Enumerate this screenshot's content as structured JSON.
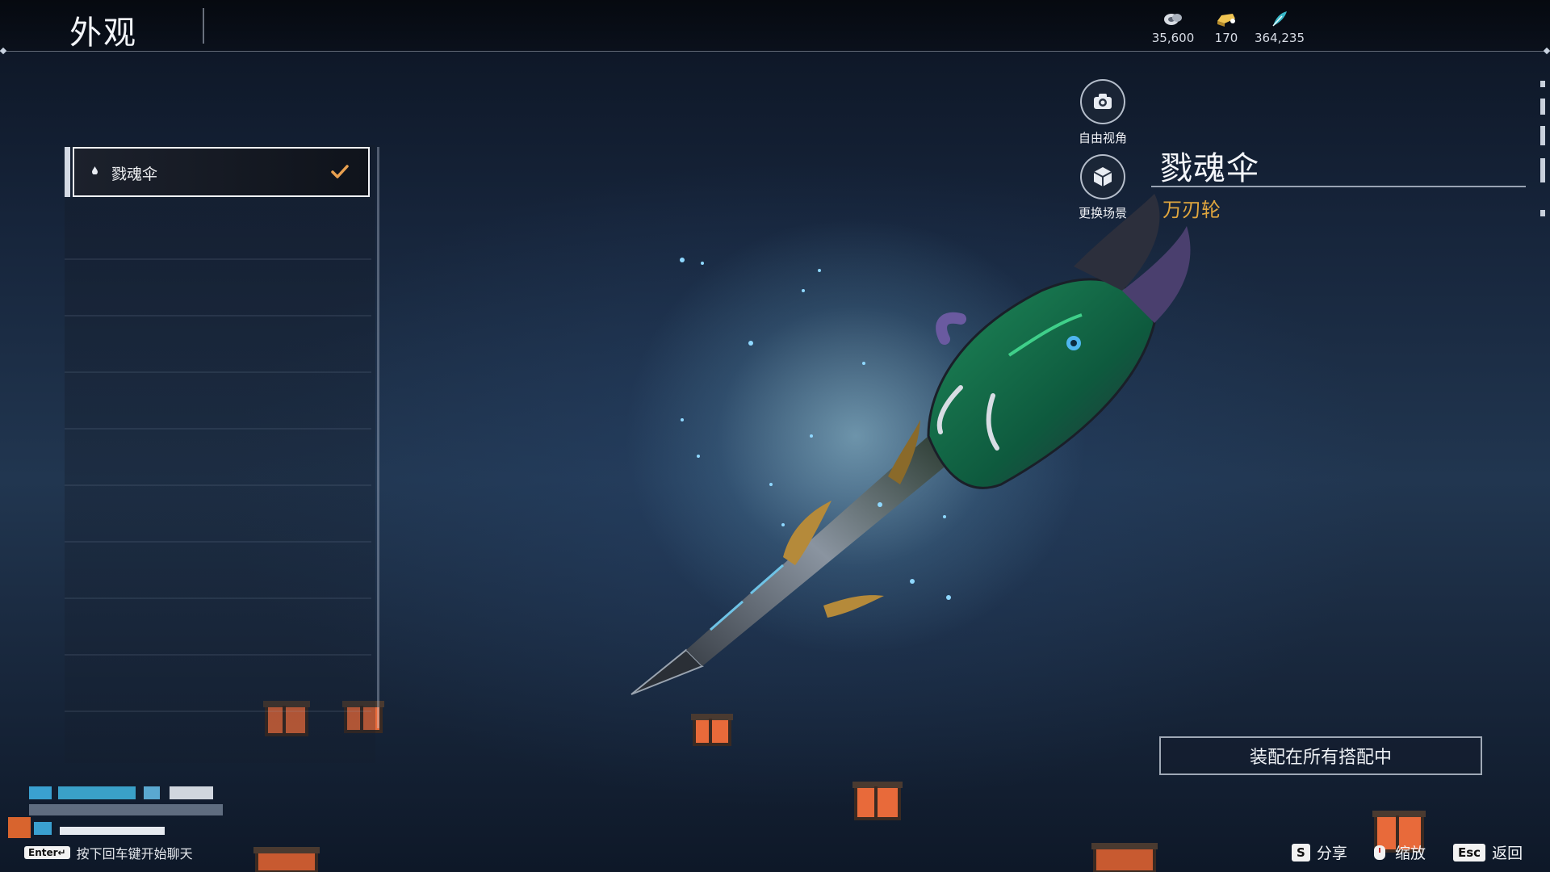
{
  "header": {
    "title": "外观"
  },
  "currencies": [
    {
      "icon": "silver-coins-icon",
      "value": "35,600"
    },
    {
      "icon": "gold-ingot-icon",
      "value": "170"
    },
    {
      "icon": "jade-feather-icon",
      "value": "364,235"
    }
  ],
  "appearance_list": {
    "items": [
      {
        "name": "戮魂伞",
        "selected": true
      }
    ]
  },
  "side_buttons": {
    "free_view_label": "自由视角",
    "change_scene_label": "更换场景"
  },
  "item_detail": {
    "name": "戮魂伞",
    "category": "万刃轮"
  },
  "actions": {
    "equip_all_label": "装配在所有搭配中"
  },
  "footer": {
    "chat_key": "Enter↵",
    "chat_hint": "按下回车键开始聊天",
    "share_key": "S",
    "share_label": "分享",
    "zoom_label": "缩放",
    "back_key": "Esc",
    "back_label": "返回"
  },
  "colors": {
    "accent_gold": "#e0a63e",
    "panel_border": "#f0f2f6"
  }
}
